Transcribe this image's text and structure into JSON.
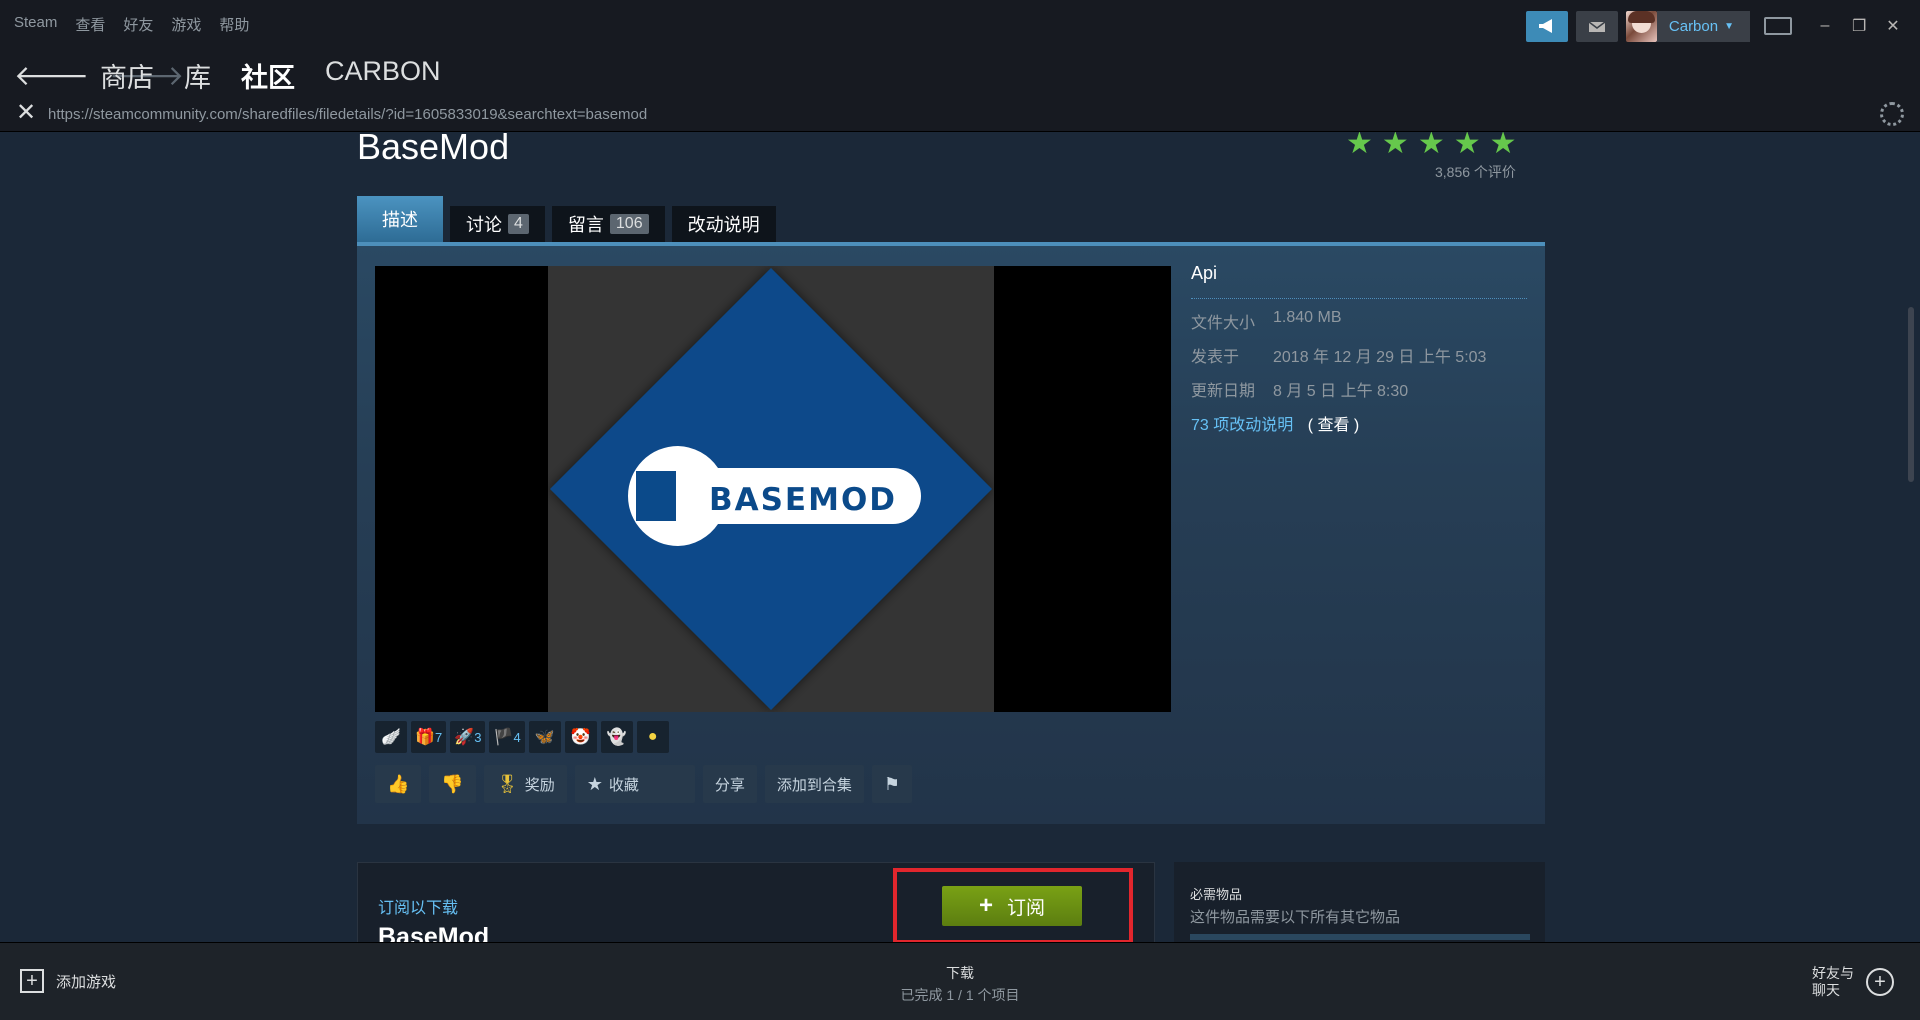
{
  "menu": {
    "items": [
      "Steam",
      "查看",
      "好友",
      "游戏",
      "帮助"
    ]
  },
  "account": {
    "name": "Carbon"
  },
  "nav": {
    "links": [
      "商店",
      "库",
      "社区",
      "CARBON"
    ],
    "active_index": 2
  },
  "url": {
    "value": "https://steamcommunity.com/sharedfiles/filedetails/?id=1605833019&searchtext=basemod"
  },
  "item": {
    "title": "BaseMod",
    "stars": 5,
    "rating_count": "3,856 个评价",
    "tabs": [
      {
        "label": "描述",
        "count": ""
      },
      {
        "label": "讨论",
        "count": "4"
      },
      {
        "label": "留言",
        "count": "106"
      },
      {
        "label": "改动说明",
        "count": ""
      }
    ],
    "preview_logo_text": "BASEMOD",
    "author": "Api",
    "stats": [
      {
        "key": "文件大小",
        "value": "1.840 MB"
      },
      {
        "key": "发表于",
        "value": "2018 年 12 月 29 日 上午 5:03"
      },
      {
        "key": "更新日期",
        "value": "8 月 5 日 上午 8:30"
      }
    ],
    "change_notes": {
      "link": "73 项改动说明",
      "view": "( 查看 )"
    },
    "awards": [
      {
        "icon": "wings-award-icon",
        "count": ""
      },
      {
        "icon": "gift-award-icon",
        "count": "7"
      },
      {
        "icon": "rocket-award-icon",
        "count": "3"
      },
      {
        "icon": "pirate-award-icon",
        "count": "4"
      },
      {
        "icon": "butterfly-award-icon",
        "count": ""
      },
      {
        "icon": "clown-award-icon",
        "count": ""
      },
      {
        "icon": "ghost-award-icon",
        "count": ""
      },
      {
        "icon": "spark-award-icon",
        "count": ""
      }
    ],
    "actions": {
      "award": "奖励",
      "favorite": "收藏",
      "share": "分享",
      "add_to_collection": "添加到合集"
    }
  },
  "subscribe": {
    "label": "订阅以下载",
    "name": "BaseMod",
    "button": "订阅"
  },
  "required": {
    "title": "必需物品",
    "desc": "这件物品需要以下所有其它物品"
  },
  "bottom": {
    "add_game": "添加游戏",
    "downloads_title": "下载",
    "downloads_status": "已完成 1 / 1 个项目",
    "friends_chat": "好友与聊天"
  },
  "colors": {
    "accent": "#66c0f4",
    "subscribe_green": "#79a115",
    "highlight_red": "#e2262d",
    "star_green": "#66c84c"
  }
}
